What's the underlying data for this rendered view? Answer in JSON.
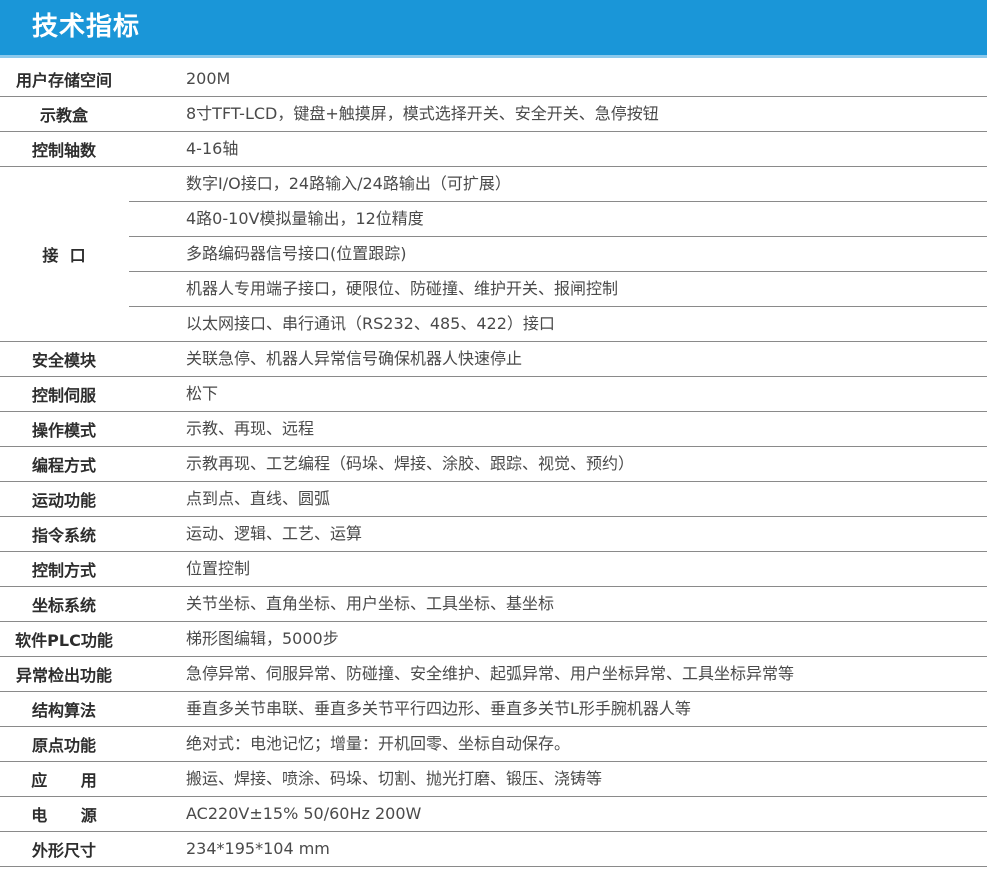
{
  "header": {
    "title": "技术指标"
  },
  "specs": [
    {
      "label": "用户存储空间",
      "values": [
        "200M"
      ]
    },
    {
      "label": "示教盒",
      "values": [
        "8寸TFT-LCD，键盘+触摸屏，模式选择开关、安全开关、急停按钮"
      ]
    },
    {
      "label": "控制轴数",
      "values": [
        "4-16轴"
      ]
    },
    {
      "label": "接  口",
      "values": [
        "数字I/O接口，24路输入/24路输出（可扩展）",
        "4路0-10V模拟量输出，12位精度",
        "多路编码器信号接口(位置跟踪)",
        "机器人专用端子接口，硬限位、防碰撞、维护开关、报闸控制",
        "以太网接口、串行通讯（RS232、485、422）接口"
      ]
    },
    {
      "label": "安全模块",
      "values": [
        "关联急停、机器人异常信号确保机器人快速停止"
      ]
    },
    {
      "label": "控制伺服",
      "values": [
        "松下"
      ]
    },
    {
      "label": "操作模式",
      "values": [
        "示教、再现、远程"
      ]
    },
    {
      "label": "编程方式",
      "values": [
        "示教再现、工艺编程（码垛、焊接、涂胶、跟踪、视觉、预约）"
      ]
    },
    {
      "label": "运动功能",
      "values": [
        "点到点、直线、圆弧"
      ]
    },
    {
      "label": "指令系统",
      "values": [
        "运动、逻辑、工艺、运算"
      ]
    },
    {
      "label": "控制方式",
      "values": [
        "位置控制"
      ]
    },
    {
      "label": "坐标系统",
      "values": [
        "关节坐标、直角坐标、用户坐标、工具坐标、基坐标"
      ]
    },
    {
      "label": "软件PLC功能",
      "values": [
        "梯形图编辑，5000步"
      ]
    },
    {
      "label": "异常检出功能",
      "values": [
        "急停异常、伺服异常、防碰撞、安全维护、起弧异常、用户坐标异常、工具坐标异常等"
      ]
    },
    {
      "label": "结构算法",
      "values": [
        "垂直多关节串联、垂直多关节平行四边形、垂直多关节L形手腕机器人等"
      ]
    },
    {
      "label": "原点功能",
      "values": [
        "绝对式：电池记忆；增量：开机回零、坐标自动保存。"
      ]
    },
    {
      "label": "应      用",
      "values": [
        "搬运、焊接、喷涂、码垛、切割、抛光打磨、锻压、浇铸等"
      ]
    },
    {
      "label": "电      源",
      "values": [
        "AC220V±15% 50/60Hz  200W"
      ]
    },
    {
      "label": "外形尺寸",
      "values": [
        "234*195*104 mm"
      ]
    }
  ]
}
